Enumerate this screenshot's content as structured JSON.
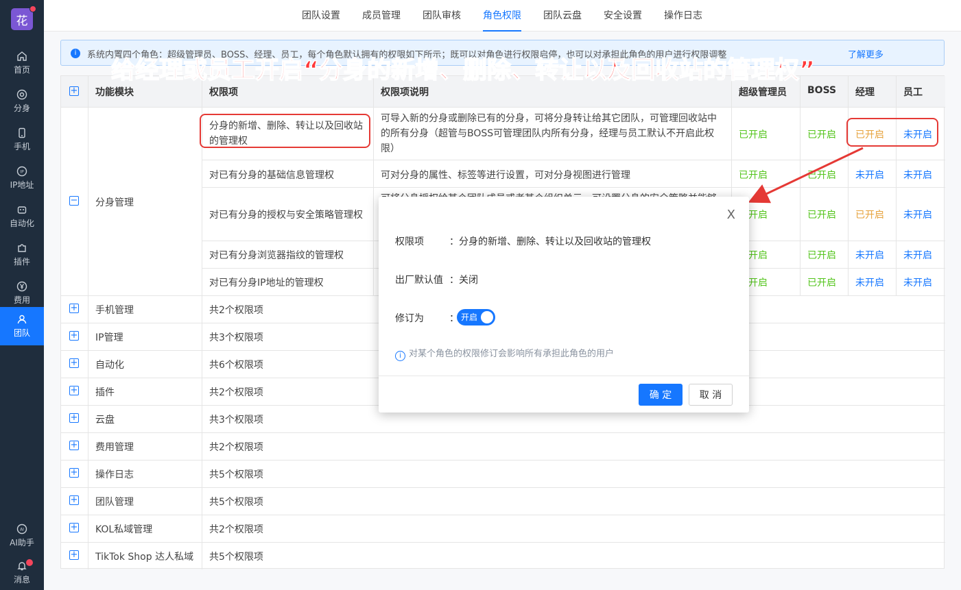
{
  "sidebar": {
    "logo": "花",
    "items": [
      {
        "label": "首页",
        "icon": "home-icon"
      },
      {
        "label": "分身",
        "icon": "chrome-icon"
      },
      {
        "label": "手机",
        "icon": "phone-icon"
      },
      {
        "label": "IP地址",
        "icon": "ip-icon"
      },
      {
        "label": "自动化",
        "icon": "robot-icon"
      },
      {
        "label": "插件",
        "icon": "puzzle-icon"
      },
      {
        "label": "费用",
        "icon": "yen-icon"
      },
      {
        "label": "团队",
        "icon": "team-icon"
      }
    ],
    "bottom": [
      {
        "label": "AI助手",
        "icon": "ai-icon"
      },
      {
        "label": "消息",
        "icon": "bell-icon"
      }
    ]
  },
  "tabs": [
    "团队设置",
    "成员管理",
    "团队审核",
    "角色权限",
    "团队云盘",
    "安全设置",
    "操作日志"
  ],
  "active_tab": "角色权限",
  "info": {
    "text": "系统内置四个角色：超级管理员、BOSS、经理、员工，每个角色默认拥有的权限如下所示；既可以对角色进行权限启停，也可以对承担此角色的用户进行权限调整",
    "link": "了解更多"
  },
  "annotation": "给经理或员工开启“分身的新增、删除、转让以及回收站的管理权”",
  "table": {
    "headers": [
      "功能模块",
      "权限项",
      "权限项说明",
      "超级管理员",
      "BOSS",
      "经理",
      "员工"
    ],
    "expanded_module": "分身管理",
    "rows": [
      {
        "item": "分身的新增、删除、转让以及回收站的管理权",
        "desc": "可导入新的分身或删除已有的分身，可将分身转让给其它团队，可管理回收站中的所有分身（超管与BOSS可管理团队内所有分身，经理与员工默认不开启此权限）",
        "vals": [
          "已开启",
          "已开启",
          "已开启",
          "未开启"
        ]
      },
      {
        "item": "对已有分身的基础信息管理权",
        "desc": "可对分身的属性、标签等进行设置，可对分身视图进行管理",
        "vals": [
          "已开启",
          "已开启",
          "未开启",
          "未开启"
        ]
      },
      {
        "item": "对已有分身的授权与安全策略管理权",
        "desc": "可将分身授权给某个团队成员或者某个组织单元，可设置分身的安全策略并能够",
        "vals": [
          "已开启",
          "已开启",
          "已开启",
          "未开启"
        ]
      },
      {
        "item": "对已有分身浏览器指纹的管理权",
        "desc": "",
        "vals": [
          "已开启",
          "已开启",
          "未开启",
          "未开启"
        ]
      },
      {
        "item": "对已有分身IP地址的管理权",
        "desc": "",
        "vals": [
          "已开启",
          "已开启",
          "未开启",
          "未开启"
        ]
      }
    ],
    "collapsed": [
      {
        "module": "手机管理",
        "count": "共2个权限项"
      },
      {
        "module": "IP管理",
        "count": "共3个权限项"
      },
      {
        "module": "自动化",
        "count": "共6个权限项"
      },
      {
        "module": "插件",
        "count": "共2个权限项"
      },
      {
        "module": "云盘",
        "count": "共3个权限项"
      },
      {
        "module": "费用管理",
        "count": "共2个权限项"
      },
      {
        "module": "操作日志",
        "count": "共5个权限项"
      },
      {
        "module": "团队管理",
        "count": "共5个权限项"
      },
      {
        "module": "KOL私域管理",
        "count": "共2个权限项"
      },
      {
        "module": "TikTok Shop 达人私域",
        "count": "共5个权限项"
      }
    ]
  },
  "modal": {
    "close": "X",
    "item_label": "权限项",
    "item_value": "：分身的新增、删除、转让以及回收站的管理权",
    "default_label": "出厂默认值",
    "default_value": "：关闭",
    "revise_label": "修订为",
    "colon": "：",
    "toggle_text": "开启",
    "note": "对某个角色的权限修订会影响所有承担此角色的用户",
    "ok": "确 定",
    "cancel": "取 消"
  },
  "colors": {
    "accent": "#1677ff",
    "enabled": "#52c41a",
    "manager_enabled": "#e6a23c",
    "annotation": "#ff3838",
    "sidebar": "#1f2d3d"
  }
}
